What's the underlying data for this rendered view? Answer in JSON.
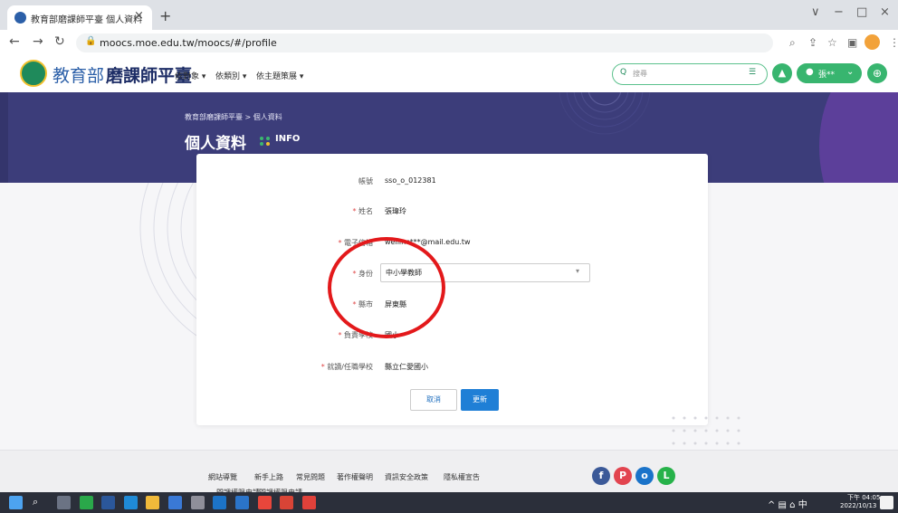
{
  "browser": {
    "tab_title": "教育部磨課師平臺 個人資料",
    "tab_close": "×",
    "new_tab": "+",
    "url": "moocs.moe.edu.tw/moocs/#/profile",
    "window_controls": [
      "∨",
      "−",
      "□",
      "×"
    ]
  },
  "site": {
    "brand_a": "教育部",
    "brand_b": "磨課師平臺",
    "nav": [
      "依對象 ▾",
      "依類別 ▾",
      "依主題策展 ▾"
    ],
    "search_placeholder": "搜尋",
    "user_name": "張**",
    "accent_color": "#38b56f"
  },
  "hero": {
    "breadcrumb": "教育部磨課師平臺 > 個人資料",
    "title": "個人資料",
    "subtitle": "INFO",
    "background": "#3c3d7a"
  },
  "profile": {
    "fields": [
      {
        "label": "帳號",
        "required": false,
        "value": "sso_o_012381"
      },
      {
        "label": "姓名",
        "required": true,
        "value": "張瑋玲"
      },
      {
        "label": "電子信箱",
        "required": true,
        "value": "weilinc***@mail.edu.tw"
      },
      {
        "label": "身份",
        "required": true,
        "value": "中小學教師"
      },
      {
        "label": "縣市",
        "required": true,
        "value": "屏東縣"
      },
      {
        "label": "負責學校",
        "required": true,
        "value": "國小"
      },
      {
        "label": "就讀/任職學校",
        "required": true,
        "value": "縣立仁愛國小"
      }
    ],
    "cancel_label": "取消",
    "update_label": "更新"
  },
  "footer": {
    "links_row1": [
      "網站導覽",
      "新手上路",
      "常見問題",
      "著作權聲明",
      "資訊安全政策",
      "隱私權宣告"
    ],
    "links_row2": [
      "開課權限申請",
      "開課權限申請"
    ]
  },
  "taskbar": {
    "clock_time": "下午 04:05",
    "clock_date": "2022/10/13",
    "ime": "中"
  }
}
